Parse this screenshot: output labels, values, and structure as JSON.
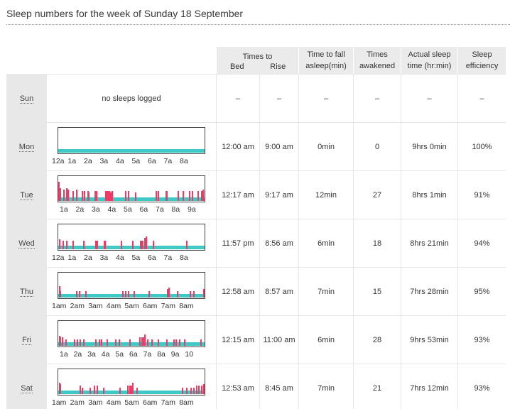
{
  "title": "Sleep numbers for the week of Sunday 18 September",
  "headers": {
    "times_to": "Times to",
    "bed": "Bed",
    "rise": "Rise",
    "fall_asleep_line1": "Time to fall",
    "fall_asleep_line2": "asleep(min)",
    "awakened_line1": "Times",
    "awakened_line2": "awakened",
    "actual_line1": "Actual sleep",
    "actual_line2": "time (hr:min)",
    "efficiency_line1": "Sleep",
    "efficiency_line2": "efficiency"
  },
  "days": [
    {
      "day": "Sun",
      "no_sleep_text": "no sleeps logged",
      "bed": "–",
      "rise": "–",
      "fall": "–",
      "awakened": "–",
      "actual": "–",
      "efficiency": "–",
      "axis_labels": [],
      "ticks": []
    },
    {
      "day": "Mon",
      "bed": "12:00 am",
      "rise": "9:00 am",
      "fall": "0min",
      "awakened": "0",
      "actual": "9hrs 0min",
      "efficiency": "100%",
      "axis_labels": [
        "12a",
        "1a",
        "2a",
        "3a",
        "4a",
        "5a",
        "6a",
        "7a",
        "8a"
      ],
      "ticks": []
    },
    {
      "day": "Tue",
      "bed": "12:17 am",
      "rise": "9:17 am",
      "fall": "12min",
      "awakened": "27",
      "actual": "8hrs 1min",
      "efficiency": "91%",
      "axis_labels": [
        "1a",
        "2a",
        "3a",
        "4a",
        "5a",
        "6a",
        "7a",
        "8a",
        "9a"
      ],
      "ticks": [
        [
          0.3,
          1
        ],
        [
          1.5,
          0.6
        ],
        [
          7,
          0.5
        ],
        [
          11,
          0.6
        ],
        [
          12.5,
          0.5
        ],
        [
          20,
          0.4
        ],
        [
          25,
          0.5
        ],
        [
          33,
          0.4
        ],
        [
          36,
          0.4
        ],
        [
          41,
          0.4
        ],
        [
          42,
          0.3
        ],
        [
          51,
          0.4
        ],
        [
          53,
          0.4
        ],
        [
          66,
          0.4
        ],
        [
          67,
          0.4
        ],
        [
          69,
          0.4
        ],
        [
          70,
          0.4
        ],
        [
          71,
          0.4
        ],
        [
          73,
          0.3
        ],
        [
          75,
          0.4
        ],
        [
          94,
          0.4
        ],
        [
          98,
          0.4
        ],
        [
          108,
          0.3
        ],
        [
          137,
          0.4
        ],
        [
          140,
          0.4
        ],
        [
          151,
          0.4
        ],
        [
          152,
          0.4
        ],
        [
          168,
          0.4
        ],
        [
          175,
          0.4
        ],
        [
          184,
          0.4
        ],
        [
          188,
          0.4
        ],
        [
          196,
          0.4
        ],
        [
          201,
          0.4
        ],
        [
          203,
          0.5
        ]
      ]
    },
    {
      "day": "Wed",
      "bed": "11:57 pm",
      "rise": "8:56 am",
      "fall": "6min",
      "awakened": "18",
      "actual": "8hrs 21min",
      "efficiency": "94%",
      "axis_labels": [
        "12a",
        "1a",
        "2a",
        "3a",
        "4a",
        "5a",
        "6a",
        "7a",
        "8a"
      ],
      "ticks": [
        [
          0.5,
          0.4
        ],
        [
          6,
          0.3
        ],
        [
          11,
          0.3
        ],
        [
          20,
          0.3
        ],
        [
          35,
          0.3
        ],
        [
          52,
          0.3
        ],
        [
          54,
          0.3
        ],
        [
          64,
          0.3
        ],
        [
          65,
          0.3
        ],
        [
          88,
          0.3
        ],
        [
          104,
          0.3
        ],
        [
          115,
          0.3
        ],
        [
          117,
          0.3
        ],
        [
          118,
          0.3
        ],
        [
          121,
          0.5
        ],
        [
          123,
          0.6
        ],
        [
          133,
          0.3
        ],
        [
          180,
          0.3
        ]
      ]
    },
    {
      "day": "Thu",
      "bed": "12:58 am",
      "rise": "8:57 am",
      "fall": "7min",
      "awakened": "15",
      "actual": "7hrs 28min",
      "efficiency": "95%",
      "axis_labels": [
        "1am",
        "2am",
        "3am",
        "4am",
        "5am",
        "6am",
        "7am",
        "8am"
      ],
      "ticks": [
        [
          0.5,
          0.5
        ],
        [
          1.5,
          0.2
        ],
        [
          25,
          0.2
        ],
        [
          29,
          0.2
        ],
        [
          38,
          0.2
        ],
        [
          90,
          0.2
        ],
        [
          94,
          0.2
        ],
        [
          98,
          0.2
        ],
        [
          106,
          0.2
        ],
        [
          127,
          0.2
        ],
        [
          153,
          0.3
        ],
        [
          155,
          0.4
        ],
        [
          167,
          0.2
        ],
        [
          185,
          0.2
        ],
        [
          190,
          0.2
        ],
        [
          205,
          0.3
        ]
      ]
    },
    {
      "day": "Fri",
      "bed": "12:15 am",
      "rise": "11:00 am",
      "fall": "6min",
      "awakened": "28",
      "actual": "9hrs 53min",
      "efficiency": "93%",
      "axis_labels": [
        "1a",
        "2a",
        "3a",
        "4a",
        "5a",
        "6a",
        "7a",
        "8a",
        "9a",
        "10"
      ],
      "ticks": [
        [
          0.5,
          0.4
        ],
        [
          2,
          0.3
        ],
        [
          5,
          0.3
        ],
        [
          10,
          0.2
        ],
        [
          22,
          0.2
        ],
        [
          26,
          0.2
        ],
        [
          30,
          0.2
        ],
        [
          35,
          0.2
        ],
        [
          52,
          0.2
        ],
        [
          57,
          0.2
        ],
        [
          60,
          0.2
        ],
        [
          68,
          0.2
        ],
        [
          80,
          0.2
        ],
        [
          85,
          0.2
        ],
        [
          100,
          0.2
        ],
        [
          114,
          0.3
        ],
        [
          117,
          0.3
        ],
        [
          119,
          0.3
        ],
        [
          121,
          0.5
        ],
        [
          125,
          0.2
        ],
        [
          131,
          0.2
        ],
        [
          140,
          0.2
        ],
        [
          152,
          0.2
        ],
        [
          162,
          0.2
        ],
        [
          165,
          0.2
        ],
        [
          170,
          0.2
        ],
        [
          177,
          0.2
        ],
        [
          200,
          0.2
        ]
      ]
    },
    {
      "day": "Sat",
      "bed": "12:53 am",
      "rise": "8:45 am",
      "fall": "7min",
      "awakened": "21",
      "actual": "7hrs 12min",
      "efficiency": "93%",
      "axis_labels": [
        "1am",
        "2am",
        "3am",
        "4am",
        "5am",
        "6am",
        "7am",
        "8am"
      ],
      "ticks": [
        [
          0.5,
          0.5
        ],
        [
          2,
          0.4
        ],
        [
          30,
          0.3
        ],
        [
          33,
          0.2
        ],
        [
          44,
          0.2
        ],
        [
          50,
          0.3
        ],
        [
          54,
          0.3
        ],
        [
          63,
          0.2
        ],
        [
          86,
          0.2
        ],
        [
          97,
          0.3
        ],
        [
          100,
          0.3
        ],
        [
          102,
          0.3
        ],
        [
          104,
          0.5
        ],
        [
          110,
          0.2
        ],
        [
          174,
          0.2
        ],
        [
          180,
          0.2
        ],
        [
          186,
          0.2
        ],
        [
          190,
          0.2
        ],
        [
          194,
          0.3
        ],
        [
          197,
          0.3
        ],
        [
          201,
          0.3
        ],
        [
          205,
          0.4
        ]
      ]
    }
  ]
}
